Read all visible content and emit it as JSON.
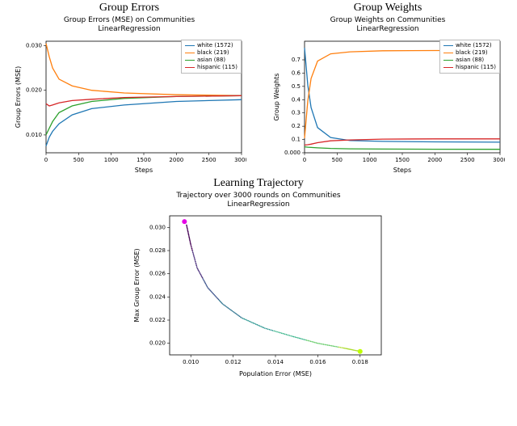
{
  "groups": [
    {
      "name": "white (1572)",
      "color": "#1f77b4"
    },
    {
      "name": "black (219)",
      "color": "#ff7f0e"
    },
    {
      "name": "asian (88)",
      "color": "#2ca02c"
    },
    {
      "name": "hispanic (115)",
      "color": "#d62728"
    }
  ],
  "errors": {
    "section_label": "Group Errors",
    "title1": "Group Errors (MSE) on Communities",
    "title2": "LinearRegression",
    "xlabel": "Steps",
    "ylabel": "Group Errors (MSE)",
    "xlim": [
      0,
      3000
    ],
    "ylim": [
      0.006,
      0.031
    ],
    "xticks": [
      0,
      500,
      1000,
      1500,
      2000,
      2500,
      3000
    ],
    "yticks": [
      0.01,
      0.02,
      0.03
    ]
  },
  "weights": {
    "section_label": "Group Weights",
    "title1": "Group Weights on Communities",
    "title2": "LinearRegression",
    "xlabel": "Steps",
    "ylabel": "Group Weights",
    "xlim": [
      0,
      3000
    ],
    "ylim": [
      0,
      0.84
    ],
    "xticks": [
      0,
      500,
      1000,
      1500,
      2000,
      2500,
      3000
    ],
    "yticks": [
      0.0,
      0.1,
      0.2,
      0.3,
      0.4,
      0.5,
      0.6,
      0.7
    ]
  },
  "trajectory": {
    "section_label": "Learning Trajectory",
    "title1": "Trajectory over 3000 rounds on Communities",
    "title2": "LinearRegression",
    "xlabel": "Population Error (MSE)",
    "ylabel": "Max Group Error (MSE)",
    "xlim": [
      0.009,
      0.019
    ],
    "ylim": [
      0.019,
      0.031
    ],
    "xticks": [
      0.01,
      0.012,
      0.014,
      0.016,
      0.018
    ],
    "yticks": [
      0.02,
      0.022,
      0.024,
      0.026,
      0.028,
      0.03
    ]
  },
  "chart_data": [
    {
      "type": "line",
      "id": "group-errors",
      "title": "Group Errors (MSE) on Communities — LinearRegression",
      "xlabel": "Steps",
      "ylabel": "Group Errors (MSE)",
      "xlim": [
        0,
        3000
      ],
      "ylim": [
        0.006,
        0.031
      ],
      "x": [
        0,
        50,
        100,
        200,
        400,
        700,
        1200,
        2000,
        3000
      ],
      "series": [
        {
          "name": "white (1572)",
          "color": "#1f77b4",
          "values": [
            0.0075,
            0.0095,
            0.0108,
            0.0125,
            0.0145,
            0.0159,
            0.0167,
            0.0175,
            0.0179
          ]
        },
        {
          "name": "black (219)",
          "color": "#ff7f0e",
          "values": [
            0.0305,
            0.0275,
            0.025,
            0.0225,
            0.021,
            0.02,
            0.0194,
            0.019,
            0.0188
          ]
        },
        {
          "name": "asian (88)",
          "color": "#2ca02c",
          "values": [
            0.01,
            0.0115,
            0.013,
            0.015,
            0.0165,
            0.0175,
            0.0182,
            0.0186,
            0.0188
          ]
        },
        {
          "name": "hispanic (115)",
          "color": "#d62728",
          "values": [
            0.017,
            0.0165,
            0.0167,
            0.0172,
            0.0177,
            0.018,
            0.0184,
            0.0186,
            0.0188
          ]
        }
      ]
    },
    {
      "type": "line",
      "id": "group-weights",
      "title": "Group Weights on Communities — LinearRegression",
      "xlabel": "Steps",
      "ylabel": "Group Weights",
      "xlim": [
        0,
        3000
      ],
      "ylim": [
        0,
        0.84
      ],
      "x": [
        0,
        50,
        100,
        200,
        400,
        700,
        1200,
        2000,
        3000
      ],
      "series": [
        {
          "name": "white (1572)",
          "color": "#1f77b4",
          "values": [
            0.79,
            0.51,
            0.34,
            0.19,
            0.115,
            0.092,
            0.086,
            0.082,
            0.08
          ]
        },
        {
          "name": "black (219)",
          "color": "#ff7f0e",
          "values": [
            0.11,
            0.39,
            0.56,
            0.69,
            0.745,
            0.76,
            0.768,
            0.77,
            0.77
          ]
        },
        {
          "name": "asian (88)",
          "color": "#2ca02c",
          "values": [
            0.045,
            0.042,
            0.04,
            0.037,
            0.033,
            0.03,
            0.028,
            0.027,
            0.026
          ]
        },
        {
          "name": "hispanic (115)",
          "color": "#d62728",
          "values": [
            0.058,
            0.061,
            0.065,
            0.076,
            0.09,
            0.097,
            0.103,
            0.105,
            0.105
          ]
        }
      ]
    },
    {
      "type": "scatter",
      "id": "learning-trajectory",
      "title": "Trajectory over 3000 rounds on Communities — LinearRegression",
      "xlabel": "Population Error (MSE)",
      "ylabel": "Max Group Error (MSE)",
      "xlim": [
        0.009,
        0.019
      ],
      "ylim": [
        0.019,
        0.031
      ],
      "start_marker": {
        "x": 0.0097,
        "y": 0.0305,
        "color": "#e600e6",
        "size": 4
      },
      "end_marker": {
        "x": 0.018,
        "y": 0.0193,
        "color": "#bfff00",
        "size": 4
      },
      "colormap": "viridis",
      "curve_points": [
        {
          "x": 0.0098,
          "y": 0.0302
        },
        {
          "x": 0.01,
          "y": 0.0285
        },
        {
          "x": 0.0103,
          "y": 0.0265
        },
        {
          "x": 0.0108,
          "y": 0.0248
        },
        {
          "x": 0.0115,
          "y": 0.0234
        },
        {
          "x": 0.0124,
          "y": 0.0222
        },
        {
          "x": 0.0135,
          "y": 0.0213
        },
        {
          "x": 0.0148,
          "y": 0.0206
        },
        {
          "x": 0.016,
          "y": 0.02
        },
        {
          "x": 0.0172,
          "y": 0.0196
        },
        {
          "x": 0.018,
          "y": 0.0193
        }
      ]
    }
  ]
}
